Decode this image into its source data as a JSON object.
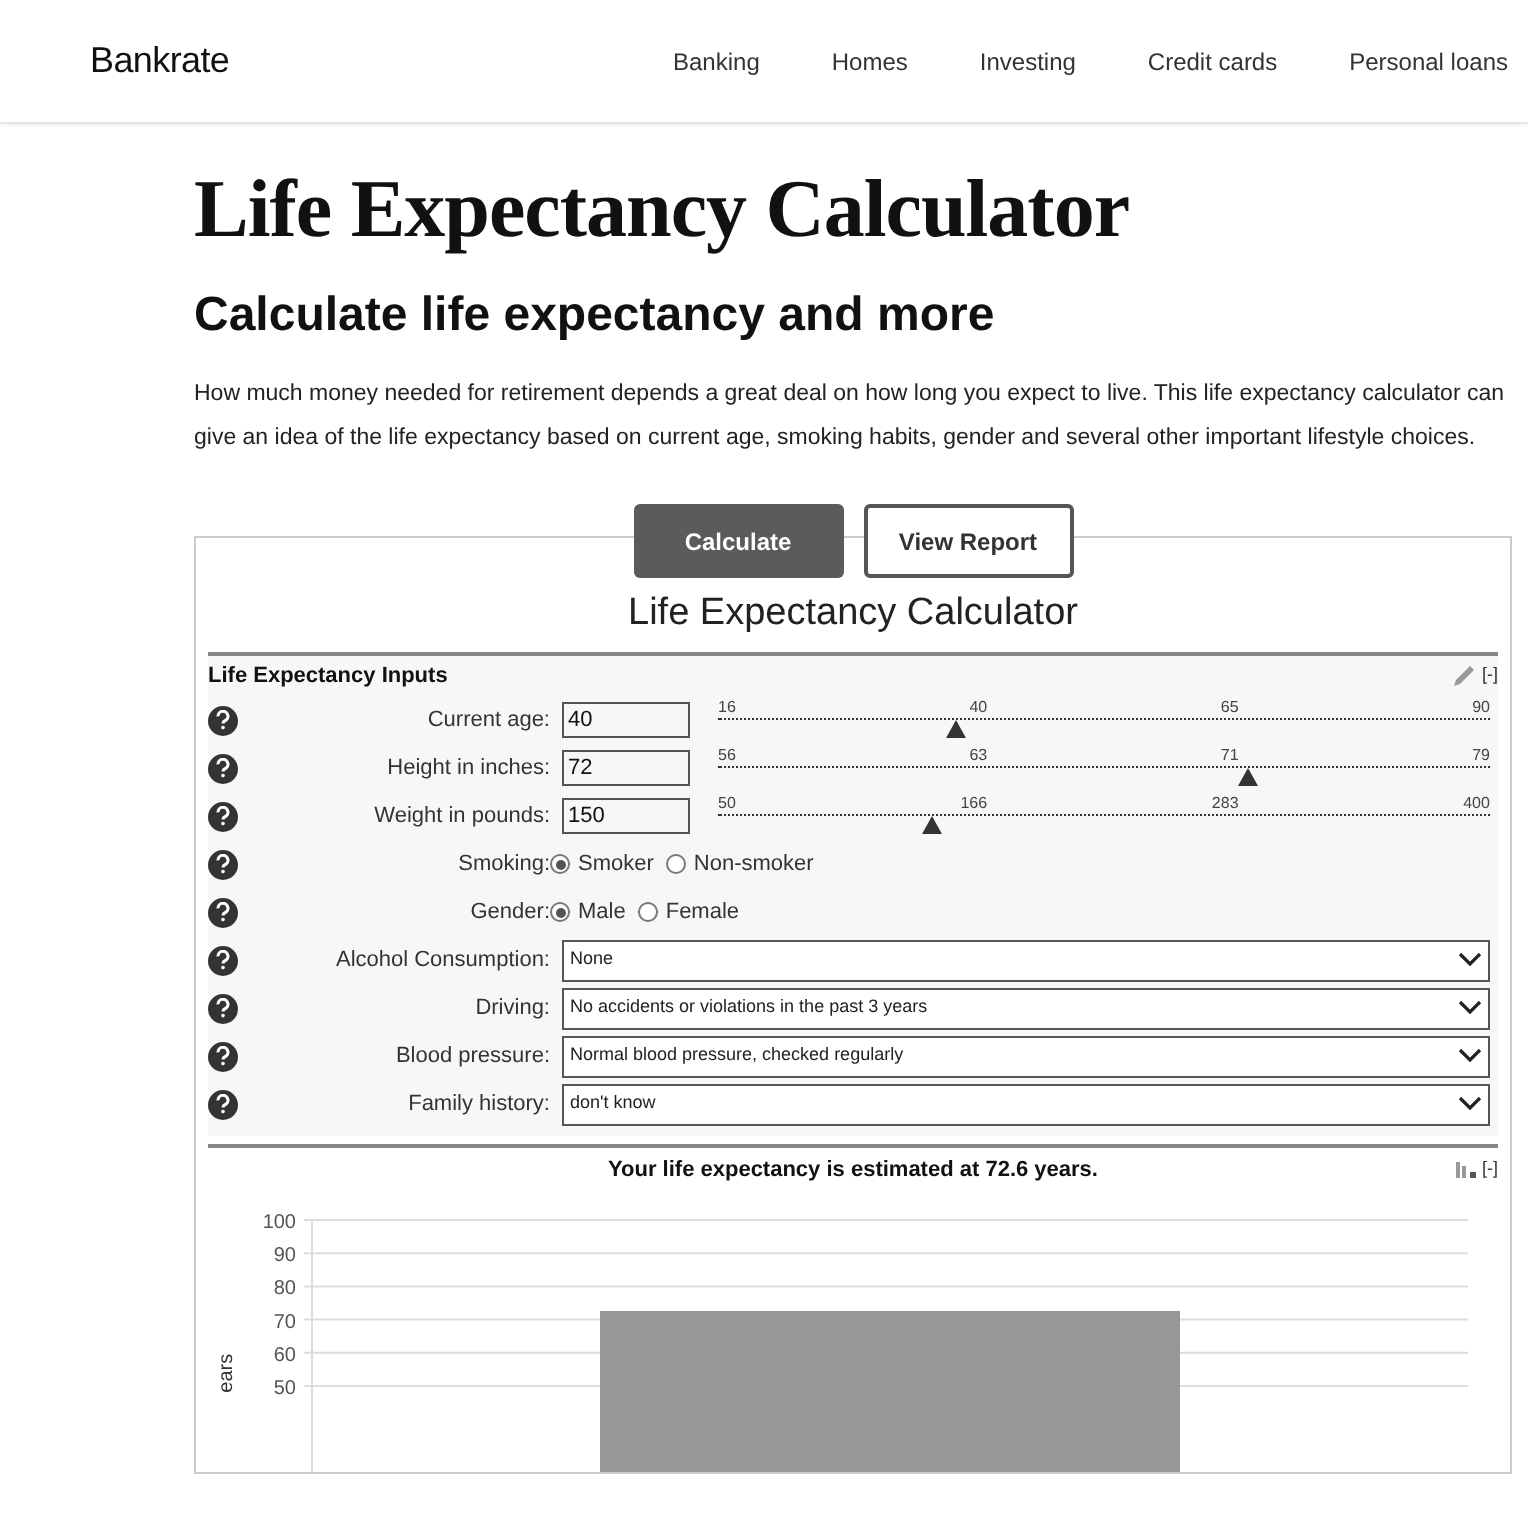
{
  "header": {
    "logo": "Bankrate",
    "nav": [
      "Banking",
      "Homes",
      "Investing",
      "Credit cards",
      "Personal loans"
    ]
  },
  "title": "Life Expectancy Calculator",
  "subtitle": "Calculate life expectancy and more",
  "intro": "How much money needed for retirement depends a great deal on how long you expect to live. This life expectancy calculator can give an idea of the life expectancy based on current age, smoking habits, gender and several other important lifestyle choices.",
  "buttons": [
    {
      "label": "Calculate",
      "selected": true
    },
    {
      "label": "View Report",
      "selected": false
    }
  ],
  "calculator": {
    "title": "Life Expectancy Calculator",
    "section_title": "Life Expectancy Inputs",
    "collapse": "[-]",
    "inputs": [
      {
        "kind": "number",
        "label": "Current age:",
        "value": "40",
        "level": 0.32,
        "ticks": [
          "16",
          "40",
          "65",
          "90"
        ]
      },
      {
        "kind": "number",
        "label": "Height in inches:",
        "value": "72",
        "level": 0.7,
        "ticks": [
          "56",
          "63",
          "71",
          "79"
        ]
      },
      {
        "kind": "number",
        "label": "Weight in pounds:",
        "value": "150",
        "level": 0.29,
        "ticks": [
          "50",
          "166",
          "283",
          "400"
        ]
      },
      {
        "kind": "radio",
        "label": "Smoking:",
        "options": [
          {
            "label": "Smoker",
            "selected": true
          },
          {
            "label": "Non-smoker",
            "selected": false
          }
        ]
      },
      {
        "kind": "radio",
        "label": "Gender:",
        "options": [
          {
            "label": "Male",
            "selected": true
          },
          {
            "label": "Female",
            "selected": false
          }
        ]
      },
      {
        "kind": "select",
        "label": "Alcohol Consumption:",
        "value": "None"
      },
      {
        "kind": "select",
        "label": "Driving:",
        "value": "No accidents or violations in the past 3 years"
      },
      {
        "kind": "select",
        "label": "Blood pressure:",
        "value": "Normal blood pressure, checked regularly"
      },
      {
        "kind": "select",
        "label": "Family history:",
        "value": "don't know"
      }
    ]
  },
  "result": {
    "title": "Your life expectancy is estimated at 72.6 years.",
    "collapse": "[-]",
    "chart_data": {
      "type": "bar",
      "ylabel": "ears",
      "values": [
        72.6
      ],
      "ylim": [
        0,
        100
      ],
      "grid": true,
      "yticks": [
        50,
        60,
        70,
        80,
        90,
        100
      ]
    }
  }
}
